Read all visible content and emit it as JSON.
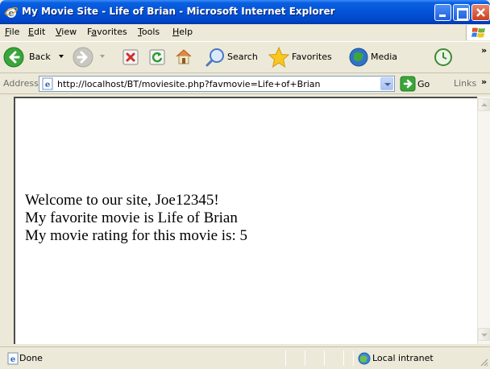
{
  "window": {
    "title": "My Movie Site - Life of Brian - Microsoft Internet Explorer"
  },
  "menu": {
    "items": [
      {
        "label": "File",
        "underline": "F",
        "rest": "ile"
      },
      {
        "label": "Edit",
        "underline": "E",
        "rest": "dit"
      },
      {
        "label": "View",
        "underline": "V",
        "rest": "iew"
      },
      {
        "label": "Favorites",
        "underline": "a",
        "pre": "F",
        "rest": "vorites"
      },
      {
        "label": "Tools",
        "underline": "T",
        "rest": "ools"
      },
      {
        "label": "Help",
        "underline": "H",
        "rest": "elp"
      }
    ]
  },
  "toolbar": {
    "back_label": "Back",
    "search_label": "Search",
    "favorites_label": "Favorites",
    "media_label": "Media",
    "more": "»"
  },
  "address": {
    "label": "Address",
    "url": "http://localhost/BT/moviesite.php?favmovie=Life+of+Brian",
    "go_label": "Go",
    "links_label": "Links",
    "links_more": "»"
  },
  "page": {
    "lines": [
      "Welcome to our site, Joe12345!",
      "My favorite movie is Life of Brian",
      "My movie rating for this movie is: 5"
    ]
  },
  "status": {
    "text": "Done",
    "zone": "Local intranet"
  },
  "colors": {
    "titlebar": "#0353d8",
    "chrome": "#ece9d8"
  },
  "icons": [
    "ie-icon",
    "minimize-icon",
    "maximize-icon",
    "close-icon",
    "windows-logo-icon",
    "back-arrow-icon",
    "forward-arrow-icon",
    "stop-icon",
    "refresh-icon",
    "home-icon",
    "search-icon",
    "favorites-star-icon",
    "media-icon",
    "history-icon",
    "page-icon",
    "go-arrow-icon",
    "local-intranet-icon",
    "resize-grip-icon"
  ]
}
